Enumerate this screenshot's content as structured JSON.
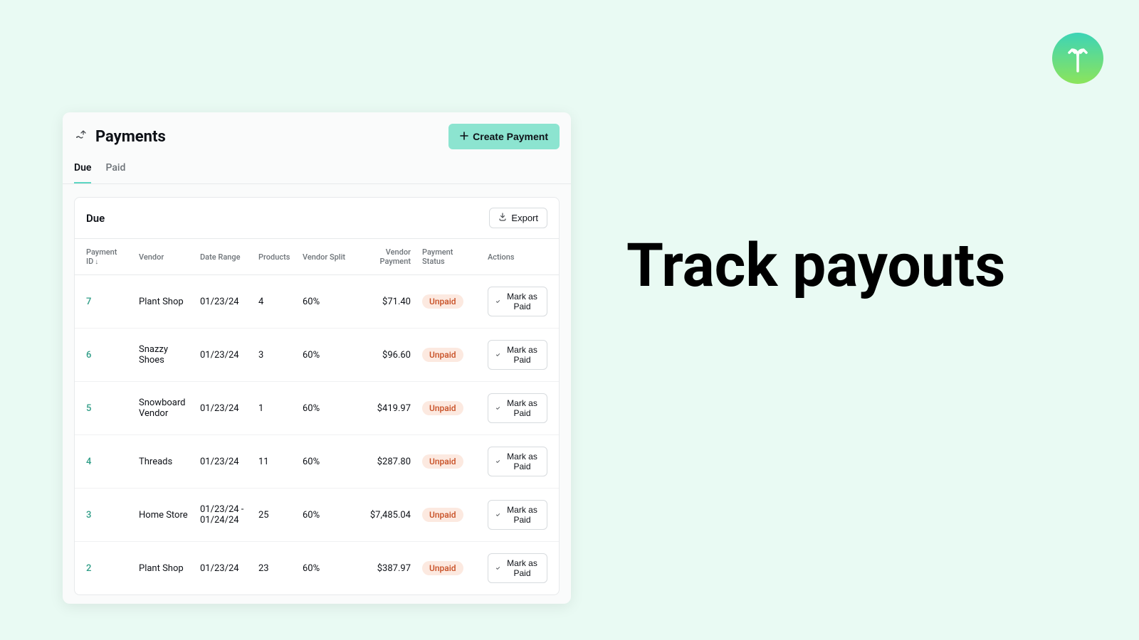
{
  "headline": "Track payouts",
  "page": {
    "title": "Payments",
    "create_label": "Create Payment"
  },
  "tabs": [
    "Due",
    "Paid"
  ],
  "card": {
    "title": "Due",
    "export_label": "Export"
  },
  "columns": {
    "payment_id": "Payment ID",
    "vendor": "Vendor",
    "date_range": "Date Range",
    "products": "Products",
    "vendor_split": "Vendor Split",
    "vendor_payment": "Vendor Payment",
    "payment_status": "Payment Status",
    "actions": "Actions"
  },
  "action_label": "Mark as Paid",
  "rows": [
    {
      "id": "7",
      "vendor": "Plant Shop",
      "date": "01/23/24",
      "products": "4",
      "split": "60%",
      "payment": "$71.40",
      "status": "Unpaid"
    },
    {
      "id": "6",
      "vendor": "Snazzy Shoes",
      "date": "01/23/24",
      "products": "3",
      "split": "60%",
      "payment": "$96.60",
      "status": "Unpaid"
    },
    {
      "id": "5",
      "vendor": "Snowboard Vendor",
      "date": "01/23/24",
      "products": "1",
      "split": "60%",
      "payment": "$419.97",
      "status": "Unpaid"
    },
    {
      "id": "4",
      "vendor": "Threads",
      "date": "01/23/24",
      "products": "11",
      "split": "60%",
      "payment": "$287.80",
      "status": "Unpaid"
    },
    {
      "id": "3",
      "vendor": "Home Store",
      "date": "01/23/24 - 01/24/24",
      "products": "25",
      "split": "60%",
      "payment": "$7,485.04",
      "status": "Unpaid"
    },
    {
      "id": "2",
      "vendor": "Plant Shop",
      "date": "01/23/24",
      "products": "23",
      "split": "60%",
      "payment": "$387.97",
      "status": "Unpaid"
    }
  ]
}
